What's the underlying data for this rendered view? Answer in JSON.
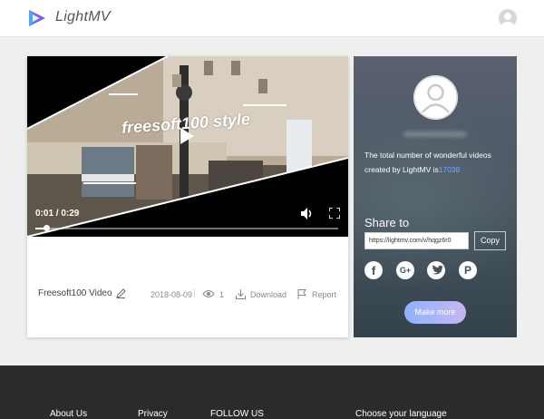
{
  "header": {
    "brand": "LightMV",
    "logo_icon": "lightmv-logo-icon",
    "account_icon": "user-avatar-icon"
  },
  "player": {
    "overlay_text": "freesoft100 style",
    "time": "0:01 / 0:29",
    "progress_fraction": 0.0345,
    "icons": [
      "play-icon",
      "volume-icon",
      "fullscreen-icon"
    ]
  },
  "video_info": {
    "title": "Freesoft100 Video",
    "date": "2018-08-09",
    "views": "1",
    "download_label": "Download",
    "report_label": "Report",
    "icons": [
      "edit-icon",
      "eye-icon",
      "download-icon",
      "flag-icon"
    ]
  },
  "sidebar": {
    "description": "The total number of wonderful videos created by LightMV is",
    "total_count": "17038",
    "share_title": "Share to",
    "share_url": "https://lightmv.com/v/hqgz6r0",
    "copy_label": "Copy",
    "social": [
      {
        "name": "facebook-icon",
        "glyph": "f"
      },
      {
        "name": "google-plus-icon",
        "glyph": "G+"
      },
      {
        "name": "twitter-icon",
        "glyph": ""
      },
      {
        "name": "pinterest-icon",
        "glyph": "P"
      }
    ],
    "make_more_label": "Make more"
  },
  "footer": {
    "about": "About Us",
    "privacy": "Privacy",
    "follow": "FOLLOW US",
    "language": "Choose your language"
  },
  "colors": {
    "accent_blue": "#6aa8ff",
    "footer_bg": "#2b2b2b",
    "page_bg": "#efefef"
  }
}
